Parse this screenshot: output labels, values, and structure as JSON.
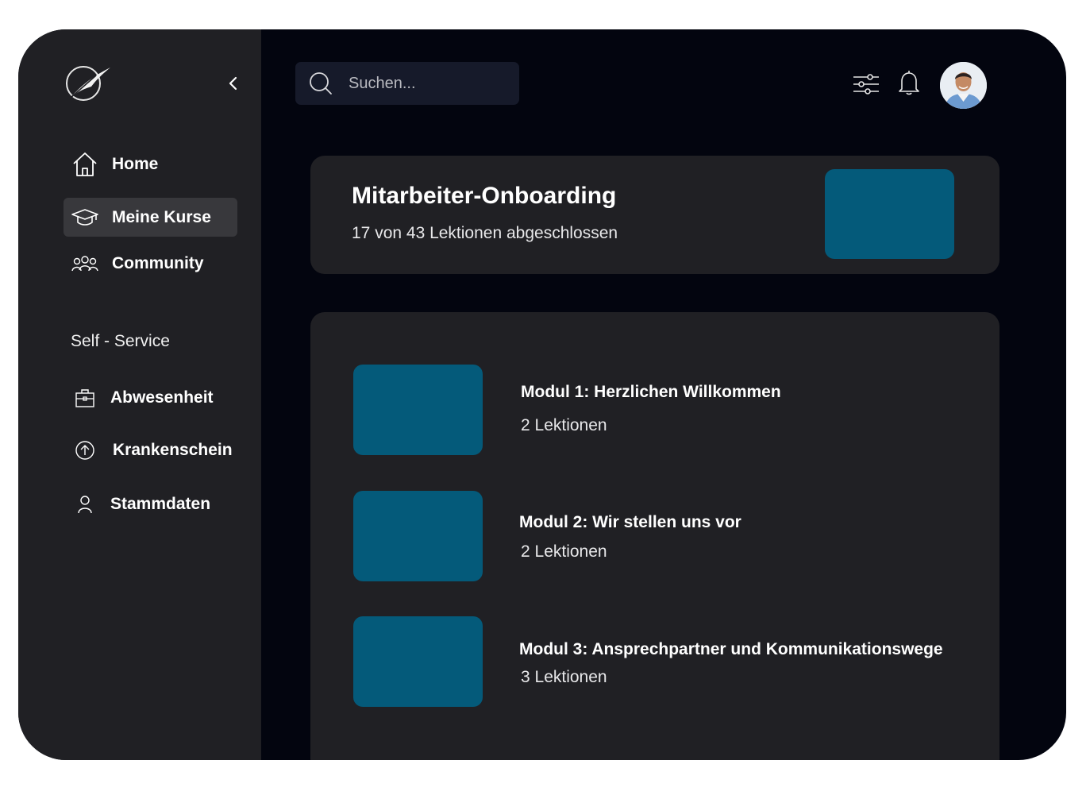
{
  "sidebar": {
    "nav": [
      {
        "label": "Home",
        "icon": "home-icon"
      },
      {
        "label": "Meine Kurse",
        "icon": "graduation-cap-icon"
      },
      {
        "label": "Community",
        "icon": "community-icon"
      }
    ],
    "section_label": "Self - Service",
    "self_service": [
      {
        "label": "Abwesenheit",
        "icon": "briefcase-icon"
      },
      {
        "label": "Krankenschein",
        "icon": "upload-circle-icon"
      },
      {
        "label": "Stammdaten",
        "icon": "user-icon"
      }
    ]
  },
  "header": {
    "search_placeholder": "Suchen..."
  },
  "course": {
    "title": "Mitarbeiter-Onboarding",
    "progress": "17 von 43 Lektionen abgeschlossen"
  },
  "modules": [
    {
      "title": "Modul 1: Herzlichen Willkommen",
      "lessons": "2 Lektionen"
    },
    {
      "title": "Modul 2: Wir stellen uns vor",
      "lessons": "2 Lektionen"
    },
    {
      "title": "Modul 3: Ansprechpartner und Kommunikationswege",
      "lessons": "3 Lektionen"
    }
  ],
  "colors": {
    "background": "#03050f",
    "sidebar": "#202024",
    "card": "#202024",
    "thumbnail": "#045a7a",
    "active_item": "#38383c"
  }
}
